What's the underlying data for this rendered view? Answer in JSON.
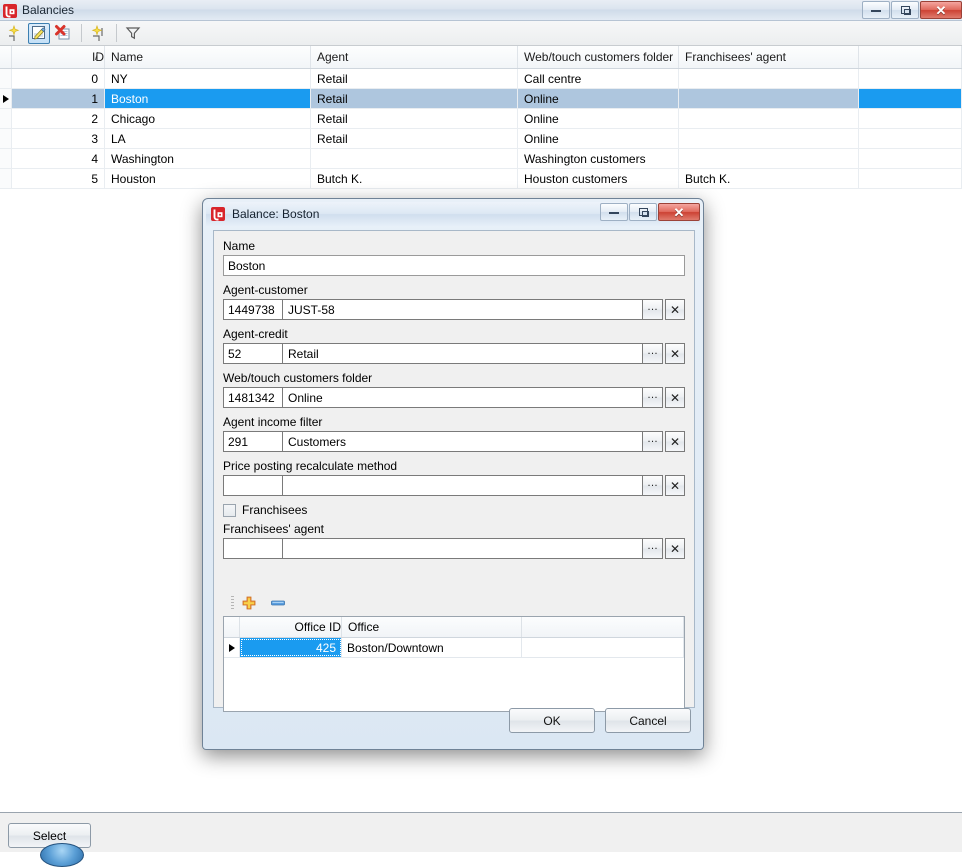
{
  "main_window": {
    "title": "Balancies",
    "icon": "app-logo-icon",
    "window_buttons": {
      "minimize": "minimize-icon",
      "maximize": "maximize-icon",
      "close": "close-icon"
    },
    "toolbar": [
      {
        "name": "new-record-button",
        "icon": "new-sparkle-icon",
        "active": false
      },
      {
        "name": "edit-record-button",
        "icon": "edit-pencil-icon",
        "active": true
      },
      {
        "name": "delete-record-button",
        "icon": "delete-cross-icon",
        "active": false
      },
      {
        "name": "copy-record-button",
        "icon": "copy-sparkle-icon",
        "active": false
      },
      {
        "name": "filter-button",
        "icon": "funnel-filter-icon",
        "active": false
      }
    ]
  },
  "grid": {
    "columns": [
      "ID",
      "Name",
      "Agent",
      "Web/touch customers folder",
      "Franchisees' agent",
      ""
    ],
    "sort_indicator": "/",
    "rows": [
      {
        "id": "0",
        "name": "NY",
        "agent": "Retail",
        "web": "Call centre",
        "fran": "",
        "selected": false
      },
      {
        "id": "1",
        "name": "Boston",
        "agent": "Retail",
        "web": "Online",
        "fran": "",
        "selected": true
      },
      {
        "id": "2",
        "name": "Chicago",
        "agent": "Retail",
        "web": "Online",
        "fran": "",
        "selected": false
      },
      {
        "id": "3",
        "name": "LA",
        "agent": "Retail",
        "web": "Online",
        "fran": "",
        "selected": false
      },
      {
        "id": "4",
        "name": "Washington",
        "agent": "",
        "web": "Washington customers",
        "fran": "",
        "selected": false
      },
      {
        "id": "5",
        "name": "Houston",
        "agent": "Butch K.",
        "web": "Houston customers",
        "fran": "Butch K.",
        "selected": false
      }
    ]
  },
  "dialog": {
    "title": "Balance: Boston",
    "icon": "app-logo-icon",
    "window_buttons": {
      "minimize": "minimize-icon",
      "maximize": "maximize-icon",
      "close": "close-icon"
    },
    "fields": {
      "name": {
        "label": "Name",
        "value": "Boston"
      },
      "agent_customer": {
        "label": "Agent-customer",
        "id": "1449738",
        "value": "JUST-58",
        "browse": "…",
        "clear": "✕"
      },
      "agent_credit": {
        "label": "Agent-credit",
        "id": "52",
        "value": "Retail",
        "browse": "…",
        "clear": "✕"
      },
      "web_folder": {
        "label": "Web/touch customers folder",
        "id": "1481342",
        "value": "Online",
        "browse": "…",
        "clear": "✕"
      },
      "income_filter": {
        "label": "Agent income filter",
        "id": "291",
        "value": "Customers",
        "browse": "…",
        "clear": "✕"
      },
      "recalc_method": {
        "label": "Price posting recalculate method",
        "id": "",
        "value": "",
        "browse": "…",
        "clear": "✕"
      },
      "franchisees_checkbox": {
        "label": "Franchisees",
        "checked": false
      },
      "franchisees_agent": {
        "label": "Franchisees' agent",
        "id": "",
        "value": "",
        "browse": "…",
        "clear": "✕"
      }
    },
    "inner_toolbar": [
      {
        "name": "add-row-button",
        "icon": "plus-icon"
      },
      {
        "name": "remove-row-button",
        "icon": "minus-icon"
      }
    ],
    "inner_grid": {
      "columns": [
        "Office ID",
        "Office",
        ""
      ],
      "rows": [
        {
          "office_id": "425",
          "office": "Boston/Downtown",
          "selected": true
        }
      ]
    },
    "buttons": {
      "ok": "OK",
      "cancel": "Cancel"
    }
  },
  "bottom_bar": {
    "select_button": "Select"
  },
  "colors": {
    "selection_blue": "#1a9bf0",
    "selection_row_tint": "#aec6de",
    "titlebar_blue": "#dbe7f3",
    "close_red": "#cc4234"
  }
}
